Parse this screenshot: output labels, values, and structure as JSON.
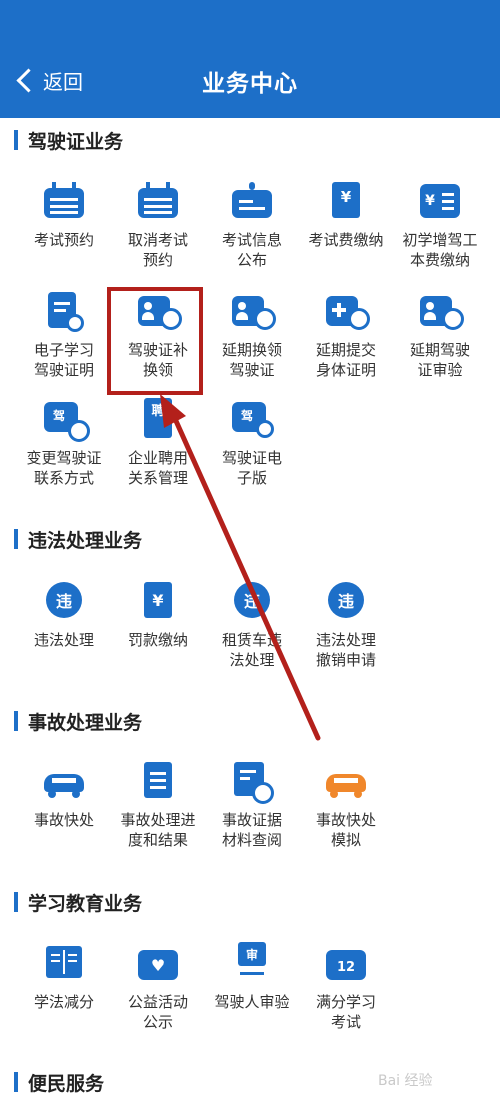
{
  "header": {
    "back_label": "返回",
    "title": "业务中心",
    "bg_color": "#1d6fc8"
  },
  "sections": [
    {
      "title": "驾驶证业务",
      "items": [
        {
          "label": "考试预约",
          "icon": "calendar-icon"
        },
        {
          "label": "取消考试\n预约",
          "icon": "calendar-cancel-icon"
        },
        {
          "label": "考试信息\n公布",
          "icon": "notice-board-icon"
        },
        {
          "label": "考试费缴纳",
          "icon": "receipt-yuan-icon"
        },
        {
          "label": "初学增驾工\n本费缴纳",
          "icon": "yuan-list-icon"
        },
        {
          "label": "电子学习\n驾驶证明",
          "icon": "e-certificate-icon"
        },
        {
          "label": "驾驶证补\n换领",
          "icon": "license-renew-icon"
        },
        {
          "label": "延期换领\n驾驶证",
          "icon": "license-clock-icon"
        },
        {
          "label": "延期提交\n身体证明",
          "icon": "health-clock-icon"
        },
        {
          "label": "延期驾驶\n证审验",
          "icon": "license-check-icon"
        },
        {
          "label": "变更驾驶证\n联系方式",
          "icon": "license-phone-icon"
        },
        {
          "label": "企业聘用\n关系管理",
          "icon": "employment-icon"
        },
        {
          "label": "驾驶证电\n子版",
          "icon": "e-license-icon"
        }
      ],
      "license_glyph": "驾",
      "employ_glyph": "聘"
    },
    {
      "title": "违法处理业务",
      "items": [
        {
          "label": "违法处理",
          "icon": "violation-search-icon"
        },
        {
          "label": "罚款缴纳",
          "icon": "fine-receipt-icon"
        },
        {
          "label": "租赁车违\n法处理",
          "icon": "rental-violation-icon"
        },
        {
          "label": "违法处理\n撤销申请",
          "icon": "violation-revoke-icon"
        }
      ],
      "violation_glyph": "违",
      "fine_glyph": "¥"
    },
    {
      "title": "事故处理业务",
      "items": [
        {
          "label": "事故快处",
          "icon": "car-accident-icon"
        },
        {
          "label": "事故处理进\n度和结果",
          "icon": "clipboard-icon"
        },
        {
          "label": "事故证据\n材料查阅",
          "icon": "evidence-search-icon"
        },
        {
          "label": "事故快处\n模拟",
          "icon": "car-accident-sim-icon"
        }
      ]
    },
    {
      "title": "学习教育业务",
      "items": [
        {
          "label": "学法减分",
          "icon": "book-icon"
        },
        {
          "label": "公益活动\n公示",
          "icon": "charity-heart-icon"
        },
        {
          "label": "驾驶人审验",
          "icon": "driver-review-icon"
        },
        {
          "label": "满分学习\n考试",
          "icon": "calendar-12-icon"
        }
      ],
      "review_glyph": "审",
      "calendar_num": "12"
    },
    {
      "title": "便民服务",
      "items": []
    }
  ],
  "watermark": "Bai 经验",
  "colors": {
    "primary": "#1d6fc8",
    "orange": "#f0872b",
    "highlight": "#b3201b"
  }
}
